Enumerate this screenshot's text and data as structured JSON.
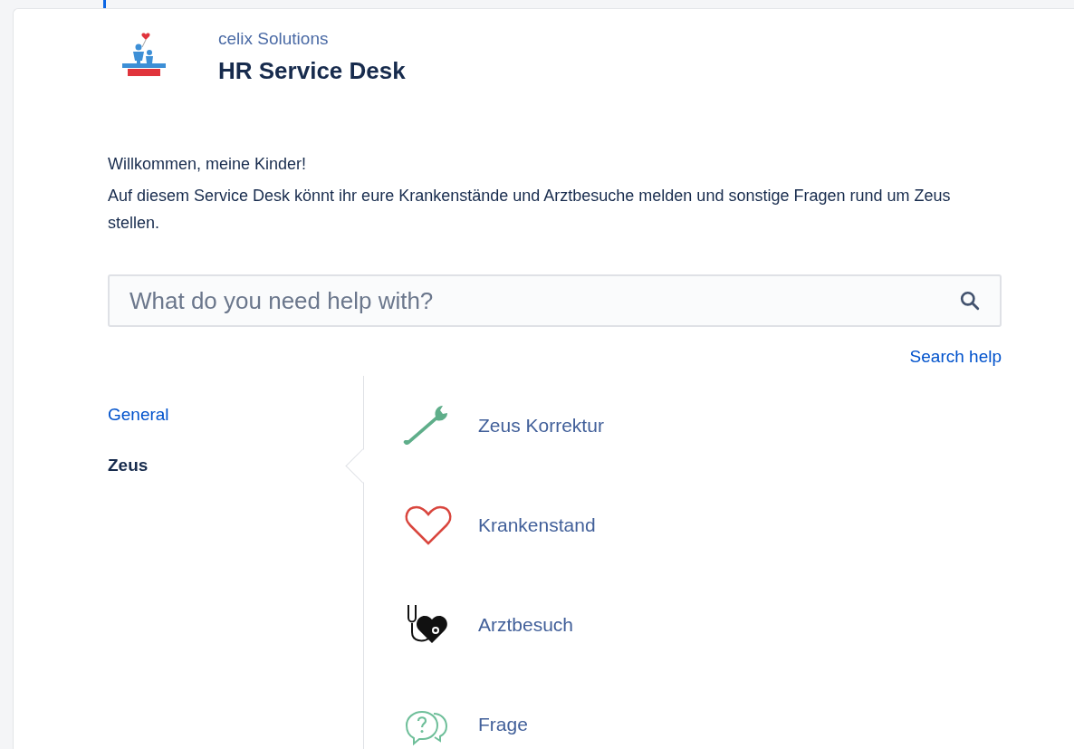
{
  "header": {
    "organization": "celix Solutions",
    "title": "HR Service Desk"
  },
  "welcome": {
    "heading": "Willkommen, meine Kinder!",
    "text": "Auf diesem Service Desk könnt ihr eure Krankenstände und Arztbesuche melden und sonstige Fragen rund um Zeus stellen."
  },
  "search": {
    "placeholder": "What do you need help with?",
    "help_link": "Search help"
  },
  "categories": [
    {
      "label": "General",
      "selected": false
    },
    {
      "label": "Zeus",
      "selected": true
    }
  ],
  "request_types": [
    {
      "kind": "wrench",
      "label": "Zeus Korrektur"
    },
    {
      "kind": "heart",
      "label": "Krankenstand"
    },
    {
      "kind": "stethoscope",
      "label": "Arztbesuch"
    },
    {
      "kind": "question",
      "label": "Frage"
    }
  ]
}
